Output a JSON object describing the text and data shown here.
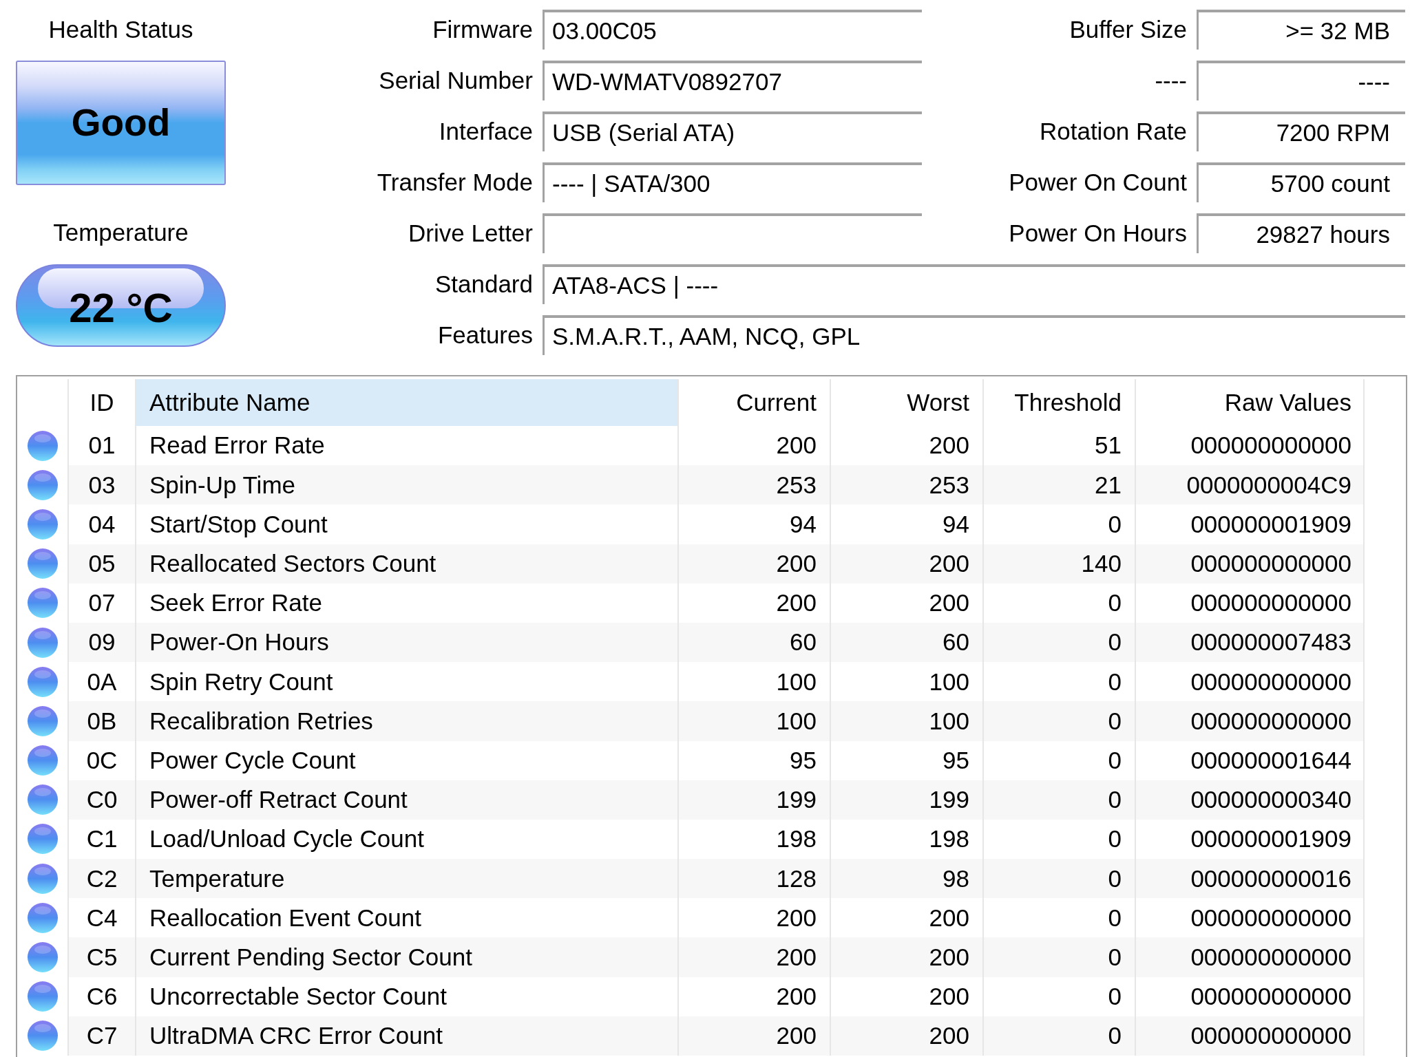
{
  "health_status": {
    "label": "Health Status",
    "value": "Good"
  },
  "temperature": {
    "label": "Temperature",
    "value": "22 °C"
  },
  "fields": [
    {
      "label": "Firmware",
      "value": "03.00C05"
    },
    {
      "label": "Serial Number",
      "value": "WD-WMATV0892707"
    },
    {
      "label": "Interface",
      "value": "USB (Serial ATA)"
    },
    {
      "label": "Transfer Mode",
      "value": "---- | SATA/300"
    },
    {
      "label": "Drive Letter"
    },
    {
      "label": "Standard",
      "value": "ATA8-ACS | ----"
    },
    {
      "label": "Features",
      "value": "S.M.A.R.T., AAM, NCQ, GPL"
    }
  ],
  "side_fields": [
    {
      "label": "Buffer Size",
      "value": ">= 32 MB"
    },
    {
      "label": "----",
      "value": "----"
    },
    {
      "label": "Rotation Rate",
      "value": "7200 RPM"
    },
    {
      "label": "Power On Count",
      "value": "5700 count"
    },
    {
      "label": "Power On Hours",
      "value": "29827 hours"
    }
  ],
  "smart_table": {
    "columns": [
      {
        "label": "ID",
        "selected": false
      },
      {
        "label": "Attribute Name",
        "selected": true
      },
      {
        "label": "Current",
        "selected": false
      },
      {
        "label": "Worst",
        "selected": false
      },
      {
        "label": "Threshold",
        "selected": false
      },
      {
        "label": "Raw Values",
        "selected": false
      }
    ],
    "rows": [
      {
        "cells": [
          "01",
          "Read Error Rate",
          "200",
          "200",
          "51",
          "000000000000"
        ]
      },
      {
        "cells": [
          "03",
          "Spin-Up Time",
          "253",
          "253",
          "21",
          "0000000004C9"
        ]
      },
      {
        "cells": [
          "04",
          "Start/Stop Count",
          "94",
          "94",
          "0",
          "000000001909"
        ]
      },
      {
        "cells": [
          "05",
          "Reallocated Sectors Count",
          "200",
          "200",
          "140",
          "000000000000"
        ]
      },
      {
        "cells": [
          "07",
          "Seek Error Rate",
          "200",
          "200",
          "0",
          "000000000000"
        ]
      },
      {
        "cells": [
          "09",
          "Power-On Hours",
          "60",
          "60",
          "0",
          "000000007483"
        ]
      },
      {
        "cells": [
          "0A",
          "Spin Retry Count",
          "100",
          "100",
          "0",
          "000000000000"
        ]
      },
      {
        "cells": [
          "0B",
          "Recalibration Retries",
          "100",
          "100",
          "0",
          "000000000000"
        ]
      },
      {
        "cells": [
          "0C",
          "Power Cycle Count",
          "95",
          "95",
          "0",
          "000000001644"
        ]
      },
      {
        "cells": [
          "C0",
          "Power-off Retract Count",
          "199",
          "199",
          "0",
          "000000000340"
        ]
      },
      {
        "cells": [
          "C1",
          "Load/Unload Cycle Count",
          "198",
          "198",
          "0",
          "000000001909"
        ]
      },
      {
        "cells": [
          "C2",
          "Temperature",
          "128",
          "98",
          "0",
          "000000000016"
        ]
      },
      {
        "cells": [
          "C4",
          "Reallocation Event Count",
          "200",
          "200",
          "0",
          "000000000000"
        ]
      },
      {
        "cells": [
          "C5",
          "Current Pending Sector Count",
          "200",
          "200",
          "0",
          "000000000000"
        ]
      },
      {
        "cells": [
          "C6",
          "Uncorrectable Sector Count",
          "200",
          "200",
          "0",
          "000000000000"
        ]
      },
      {
        "cells": [
          "C7",
          "UltraDMA CRC Error Count",
          "200",
          "200",
          "0",
          "000000000000"
        ]
      }
    ]
  }
}
